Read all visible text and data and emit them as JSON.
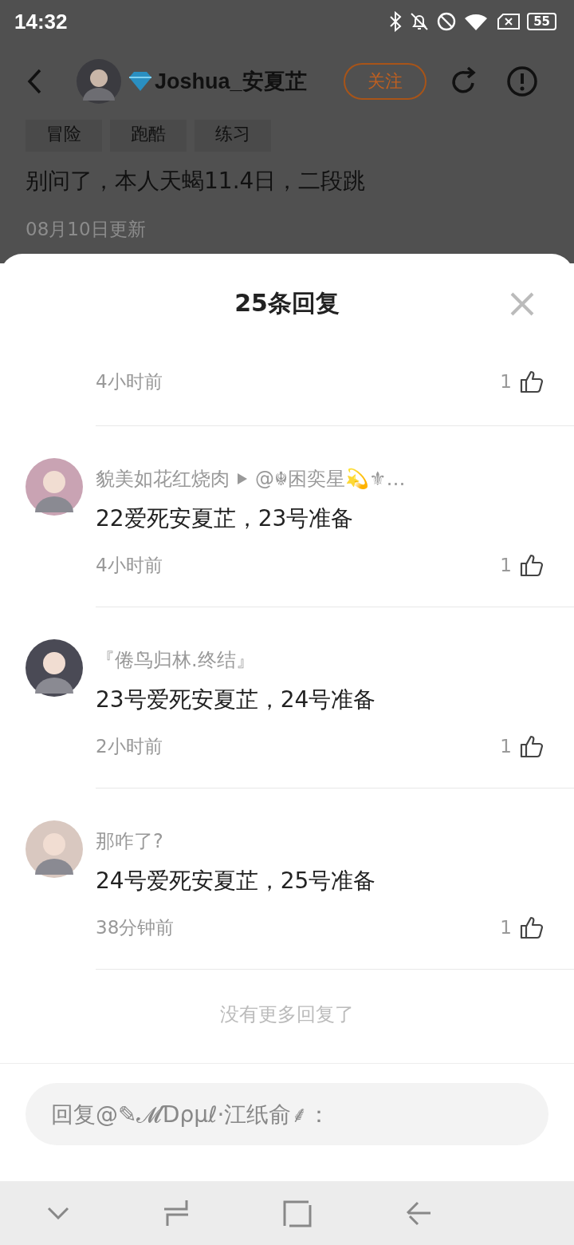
{
  "status_bar": {
    "time": "14:32",
    "battery": "55"
  },
  "header": {
    "username": "Joshua_安夏芷",
    "follow_button": "关注"
  },
  "tags": [
    "冒险",
    "跑酷",
    "练习"
  ],
  "post": {
    "text": "别问了，本人天蝎11.4日，二段跳",
    "updated": "08月10日更新"
  },
  "sheet": {
    "title": "25条回复",
    "replies": [
      {
        "time": "4小时前",
        "likes": "1"
      },
      {
        "author": "貌美如花红烧肉",
        "reply_to": "@☬困奕星💫⚜…",
        "text": "22爱死安夏芷，23号准备",
        "time": "4小时前",
        "likes": "1"
      },
      {
        "author": "『倦鸟归林.终结』",
        "text": "23号爱死安夏芷，24号准备",
        "time": "2小时前",
        "likes": "1"
      },
      {
        "author": "那咋了?",
        "text": "24号爱死安夏芷，25号准备",
        "time": "38分钟前",
        "likes": "1"
      }
    ],
    "end_note": "没有更多回复了",
    "input": {
      "placeholder": "回复@✎𝓜Ɗρμℓ·江纸俞⸙："
    }
  }
}
